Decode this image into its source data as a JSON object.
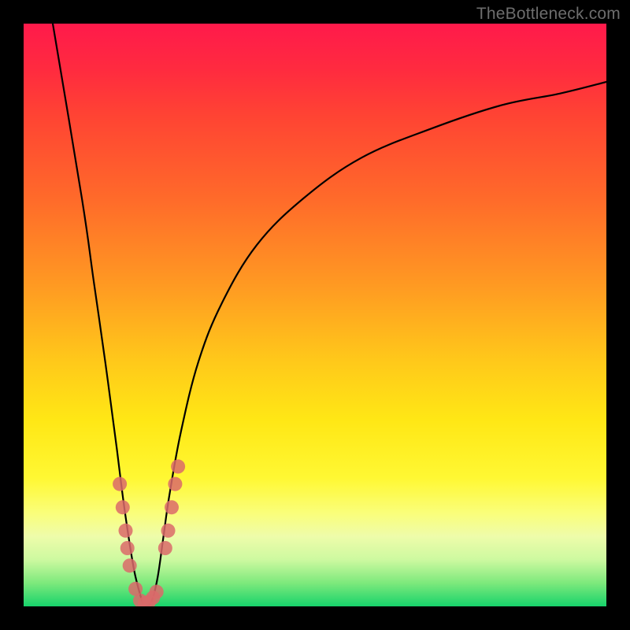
{
  "watermark": "TheBottleneck.com",
  "chart_data": {
    "type": "line",
    "title": "",
    "xlabel": "",
    "ylabel": "",
    "xlim": [
      0,
      100
    ],
    "ylim": [
      0,
      100
    ],
    "series": [
      {
        "name": "curve",
        "x": [
          5,
          10,
          12,
          14,
          16,
          17,
          18,
          19,
          20,
          20.5,
          21,
          22,
          23,
          24,
          25,
          27,
          30,
          34,
          40,
          48,
          58,
          70,
          82,
          92,
          100
        ],
        "values": [
          100,
          70,
          56,
          42,
          27,
          19,
          12,
          6,
          2,
          0.5,
          0,
          1,
          5,
          12,
          19,
          30,
          42,
          52,
          62,
          70,
          77,
          82,
          86,
          88,
          90
        ]
      }
    ],
    "scatter_points": {
      "name": "cluster",
      "color": "#db6a6a",
      "points": [
        {
          "x": 16.5,
          "y": 21
        },
        {
          "x": 17.0,
          "y": 17
        },
        {
          "x": 17.5,
          "y": 13
        },
        {
          "x": 17.8,
          "y": 10
        },
        {
          "x": 18.2,
          "y": 7
        },
        {
          "x": 19.2,
          "y": 3
        },
        {
          "x": 20.0,
          "y": 1
        },
        {
          "x": 20.8,
          "y": 0.5
        },
        {
          "x": 21.5,
          "y": 0.8
        },
        {
          "x": 22.2,
          "y": 1.5
        },
        {
          "x": 22.8,
          "y": 2.5
        },
        {
          "x": 24.3,
          "y": 10
        },
        {
          "x": 24.8,
          "y": 13
        },
        {
          "x": 25.4,
          "y": 17
        },
        {
          "x": 26.0,
          "y": 21
        },
        {
          "x": 26.5,
          "y": 24
        }
      ]
    }
  }
}
